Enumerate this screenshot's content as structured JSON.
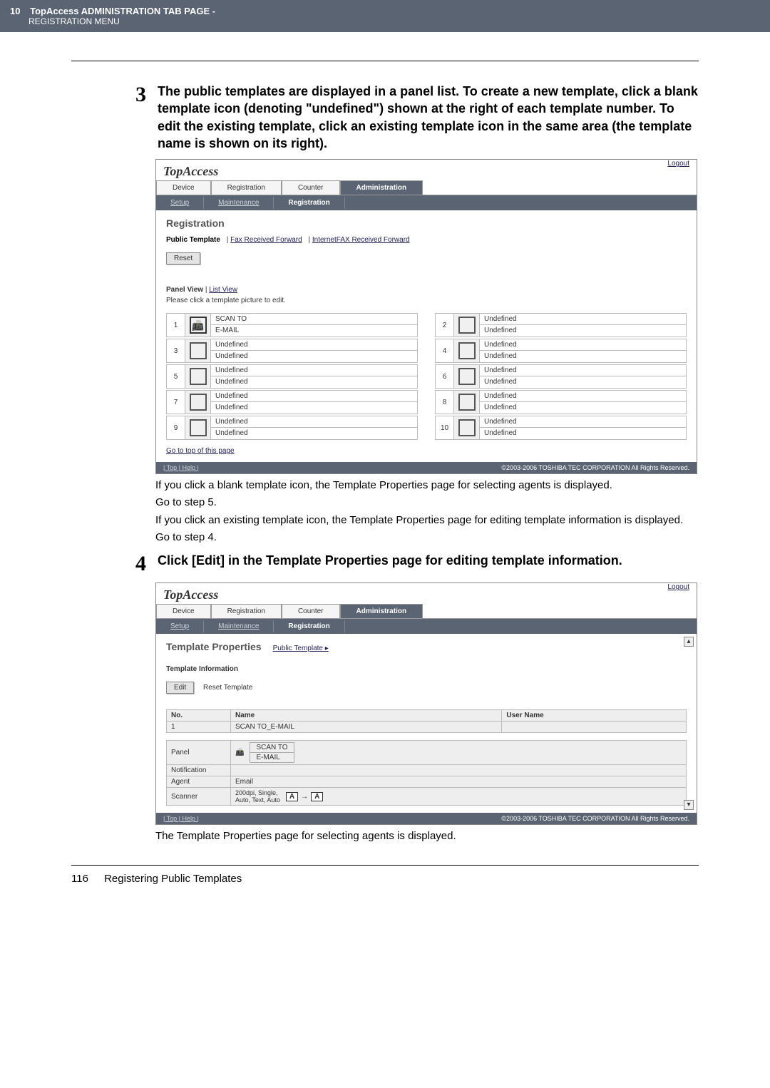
{
  "header": {
    "page_num": "10",
    "title": "TopAccess ADMINISTRATION TAB PAGE -",
    "sub": "REGISTRATION MENU"
  },
  "step3": {
    "num": "3",
    "text": "The public templates are displayed in a panel list. To create a new template, click a blank template icon (denoting \"undefined\") shown at the right of each template number. To edit the existing template, click an existing template icon in the same area (the template name is shown on its right)."
  },
  "shot1": {
    "brand": "TopAccess",
    "logout": "Logout",
    "tabs": {
      "device": "Device",
      "registration": "Registration",
      "counter": "Counter",
      "administration": "Administration"
    },
    "subtabs": {
      "setup": "Setup",
      "maintenance": "Maintenance",
      "registration": "Registration"
    },
    "heading": "Registration",
    "links": {
      "pub": "Public Template",
      "fax": "Fax Received Forward",
      "ifax": "InternetFAX Received Forward"
    },
    "reset": "Reset",
    "views": {
      "panel": "Panel View",
      "list": "List View"
    },
    "hint": "Please click a template picture to edit.",
    "scan_to": "SCAN TO",
    "email": "E-MAIL",
    "undefined": "Undefined",
    "left_nums": [
      "1",
      "3",
      "5",
      "7",
      "9"
    ],
    "right_nums": [
      "2",
      "4",
      "6",
      "8",
      "10"
    ],
    "go_top": "Go to top of this page",
    "footer_links": "| Top | Help |",
    "copyright": "©2003-2006 TOSHIBA TEC CORPORATION All Rights Reserved."
  },
  "aftershot1": {
    "l1": "If you click a blank template icon, the Template Properties page for selecting agents is displayed.",
    "l2": "Go to step 5.",
    "l3": "If you click an existing template icon, the Template Properties page for editing template information is displayed.",
    "l4": "Go to step 4."
  },
  "step4": {
    "num": "4",
    "text": "Click [Edit] in the Template Properties page for editing template information."
  },
  "shot2": {
    "brand": "TopAccess",
    "logout": "Logout",
    "tabs": {
      "device": "Device",
      "registration": "Registration",
      "counter": "Counter",
      "administration": "Administration"
    },
    "subtabs": {
      "setup": "Setup",
      "maintenance": "Maintenance",
      "registration": "Registration"
    },
    "heading": "Template Properties",
    "breadcrumb": "Public Template ▸",
    "section": "Template Information",
    "edit": "Edit",
    "reset_tpl": "Reset Template",
    "th_no": "No.",
    "th_name": "Name",
    "th_user": "User Name",
    "row_no": "1",
    "row_name": "SCAN TO_E-MAIL",
    "panel": "Panel",
    "scan_to": "SCAN TO",
    "email": "E-MAIL",
    "notification": "Notification",
    "agent": "Agent",
    "agent_v": "Email",
    "scanner": "Scanner",
    "scanner_v": "200dpi, Single,\nAuto, Text, Auto",
    "footer_links": "| Top | Help |",
    "copyright": "©2003-2006 TOSHIBA TEC CORPORATION All Rights Reserved."
  },
  "aftershot2": "The Template Properties page for selecting agents is displayed.",
  "footer": {
    "num": "116",
    "label": "Registering Public Templates"
  }
}
